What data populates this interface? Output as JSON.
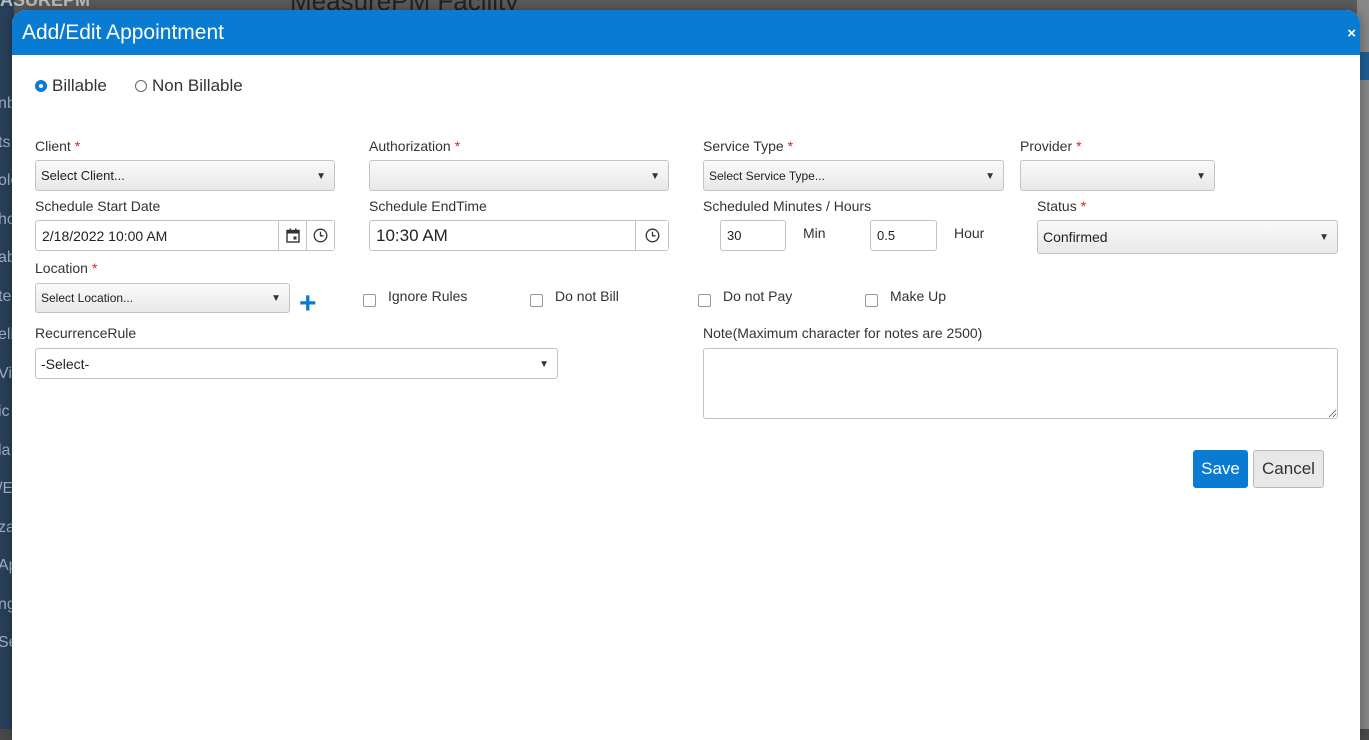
{
  "background": {
    "brand": "ASUREPM",
    "facility_title": "MeasurePM Facility",
    "side_labels": [
      "nb",
      "ts",
      "olo",
      "ho",
      "ab",
      "te",
      "eli",
      "Vi",
      "ic",
      "la",
      "/E",
      "za",
      "Ap",
      "ng",
      "Se"
    ]
  },
  "modal": {
    "title": "Add/Edit Appointment",
    "close": "×"
  },
  "billing": {
    "billable_label": "Billable",
    "non_billable_label": "Non Billable",
    "selected": "Billable"
  },
  "client": {
    "label": "Client",
    "placeholder": "Select Client..."
  },
  "authorization": {
    "label": "Authorization",
    "value": ""
  },
  "service_type": {
    "label": "Service Type",
    "placeholder": "Select Service Type..."
  },
  "provider": {
    "label": "Provider",
    "value": ""
  },
  "start_date": {
    "label": "Schedule Start Date",
    "value": "2/18/2022 10:00 AM"
  },
  "end_time": {
    "label": "Schedule EndTime",
    "value": "10:30 AM"
  },
  "scheduled": {
    "label": "Scheduled Minutes / Hours",
    "minutes": "30",
    "min_unit": "Min",
    "hours": "0.5",
    "hour_unit": "Hour"
  },
  "status": {
    "label": "Status",
    "value": "Confirmed"
  },
  "location": {
    "label": "Location",
    "placeholder": "Select Location..."
  },
  "checkboxes": {
    "ignore_rules": "Ignore Rules",
    "do_not_bill": "Do not Bill",
    "do_not_pay": "Do not Pay",
    "make_up": "Make Up"
  },
  "recurrence": {
    "label": "RecurrenceRule",
    "value": "-Select-"
  },
  "note": {
    "label": "Note(Maximum character for notes are 2500)",
    "value": ""
  },
  "required_mark": "*",
  "caret": "▼",
  "plus": "+",
  "buttons": {
    "save": "Save",
    "cancel": "Cancel"
  },
  "colors": {
    "header": "#0a7bd3",
    "required": "#e02020",
    "primary": "#0a7bd3"
  },
  "icons": {
    "calendar": "calendar-icon",
    "clock": "clock-icon",
    "caret": "caret-down-icon",
    "plus": "plus-icon",
    "close": "close-icon"
  }
}
